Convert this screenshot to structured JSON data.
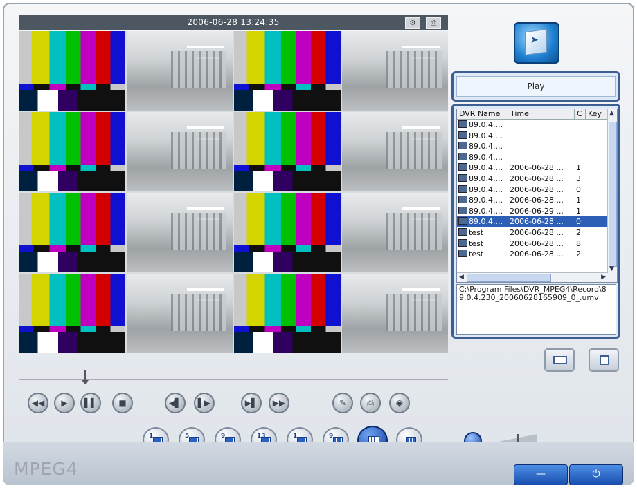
{
  "video": {
    "timestamp": "2006-06-28 13:24:35",
    "header_icons": [
      "settings-icon",
      "print-icon"
    ],
    "cells": [
      "bars",
      "cam",
      "bars",
      "cam",
      "bars",
      "cam",
      "bars",
      "cam",
      "bars",
      "cam",
      "bars",
      "cam",
      "bars",
      "cam",
      "bars",
      "cam"
    ]
  },
  "right_panel": {
    "play_label": "Play",
    "columns": [
      "DVR Name",
      "Time",
      "C",
      "Key"
    ],
    "rows": [
      {
        "name": "89.0.4....",
        "time": "",
        "c": "",
        "key": ""
      },
      {
        "name": "89.0.4....",
        "time": "",
        "c": "",
        "key": ""
      },
      {
        "name": "89.0.4....",
        "time": "",
        "c": "",
        "key": ""
      },
      {
        "name": "89.0.4....",
        "time": "",
        "c": "",
        "key": ""
      },
      {
        "name": "89.0.4....",
        "time": "2006-06-28 ...",
        "c": "1",
        "key": ""
      },
      {
        "name": "89.0.4....",
        "time": "2006-06-28 ...",
        "c": "3",
        "key": ""
      },
      {
        "name": "89.0.4....",
        "time": "2006-06-28 ...",
        "c": "0",
        "key": ""
      },
      {
        "name": "89.0.4....",
        "time": "2006-06-28 ...",
        "c": "1",
        "key": ""
      },
      {
        "name": "89.0.4....",
        "time": "2006-06-29 ...",
        "c": "1",
        "key": ""
      },
      {
        "name": "89.0.4....",
        "time": "2006-06-28 ...",
        "c": "0",
        "key": "",
        "selected": true
      },
      {
        "name": "test",
        "time": "2006-06-28 ...",
        "c": "2",
        "key": ""
      },
      {
        "name": "test",
        "time": "2006-06-28 ...",
        "c": "8",
        "key": ""
      },
      {
        "name": "test",
        "time": "2006-06-28 ...",
        "c": "2",
        "key": ""
      }
    ],
    "path_text": "C:\\Program Files\\DVR_MPEG4\\Record\\89.0.4.230_20060628165909_0_.umv"
  },
  "playback_controls": [
    {
      "name": "rewind-button",
      "glyph": "◀◀"
    },
    {
      "name": "play-button",
      "glyph": "▶"
    },
    {
      "name": "pause-button",
      "glyph": "▌▌"
    },
    {
      "name": "stop-button",
      "glyph": "■"
    },
    {
      "name": "step-back-button",
      "glyph": "◀▌"
    },
    {
      "name": "step-forward-button",
      "glyph": "▌▶"
    },
    {
      "name": "slow-button",
      "glyph": "▶▌"
    },
    {
      "name": "fast-button",
      "glyph": "▶▶"
    },
    {
      "name": "snapshot-edit-button",
      "glyph": "✎"
    },
    {
      "name": "print-button",
      "glyph": "⎙"
    },
    {
      "name": "capture-button",
      "glyph": "◉"
    }
  ],
  "layout_buttons": [
    {
      "name": "layout-1-button",
      "label": "1"
    },
    {
      "name": "layout-5-button",
      "label": "5"
    },
    {
      "name": "layout-9-button",
      "label": "9"
    },
    {
      "name": "layout-13-button",
      "label": "13"
    },
    {
      "name": "layout-1b-button",
      "label": "1"
    },
    {
      "name": "layout-9b-button",
      "label": "9"
    },
    {
      "name": "layout-16-button",
      "label": "",
      "active": true
    },
    {
      "name": "layout-pip-button",
      "label": ""
    }
  ],
  "volume": {
    "level": 0.6
  },
  "footer": {
    "brand": "MPEG4",
    "minimize_glyph": "—",
    "power_glyph": "⏻"
  }
}
